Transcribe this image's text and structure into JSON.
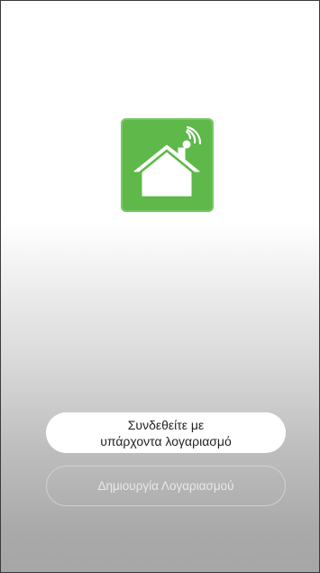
{
  "logo": {
    "icon": "smart-home-icon",
    "background_color": "#5fb84a"
  },
  "buttons": {
    "login_label": "Συνδεθείτε με\nυπάρχοντα λογαριασμό",
    "create_account_label": "Δημιουργία Λογαριασμού"
  }
}
